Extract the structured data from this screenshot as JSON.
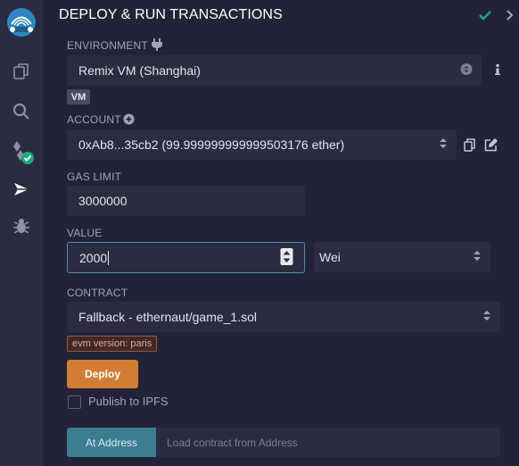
{
  "header": {
    "title": "DEPLOY & RUN TRANSACTIONS"
  },
  "environment": {
    "label": "ENVIRONMENT",
    "value": "Remix VM (Shanghai)",
    "badge": "VM"
  },
  "account": {
    "label": "ACCOUNT",
    "value": "0xAb8...35cb2 (99.999999999999503176 ether)"
  },
  "gas_limit": {
    "label": "GAS LIMIT",
    "value": "3000000"
  },
  "value": {
    "label": "VALUE",
    "amount": "2000",
    "unit": "Wei"
  },
  "contract": {
    "label": "CONTRACT",
    "value": "Fallback - ethernaut/game_1.sol",
    "evm_badge": "evm version: paris"
  },
  "deploy": {
    "label": "Deploy"
  },
  "publish": {
    "label": "Publish to IPFS",
    "checked": false
  },
  "at_address": {
    "button": "At Address",
    "placeholder": "Load contract from Address"
  },
  "colors": {
    "accent": "#d27d36",
    "brand": "#3b7e93",
    "success": "#1ea97c",
    "warning": "#f2a67a"
  }
}
